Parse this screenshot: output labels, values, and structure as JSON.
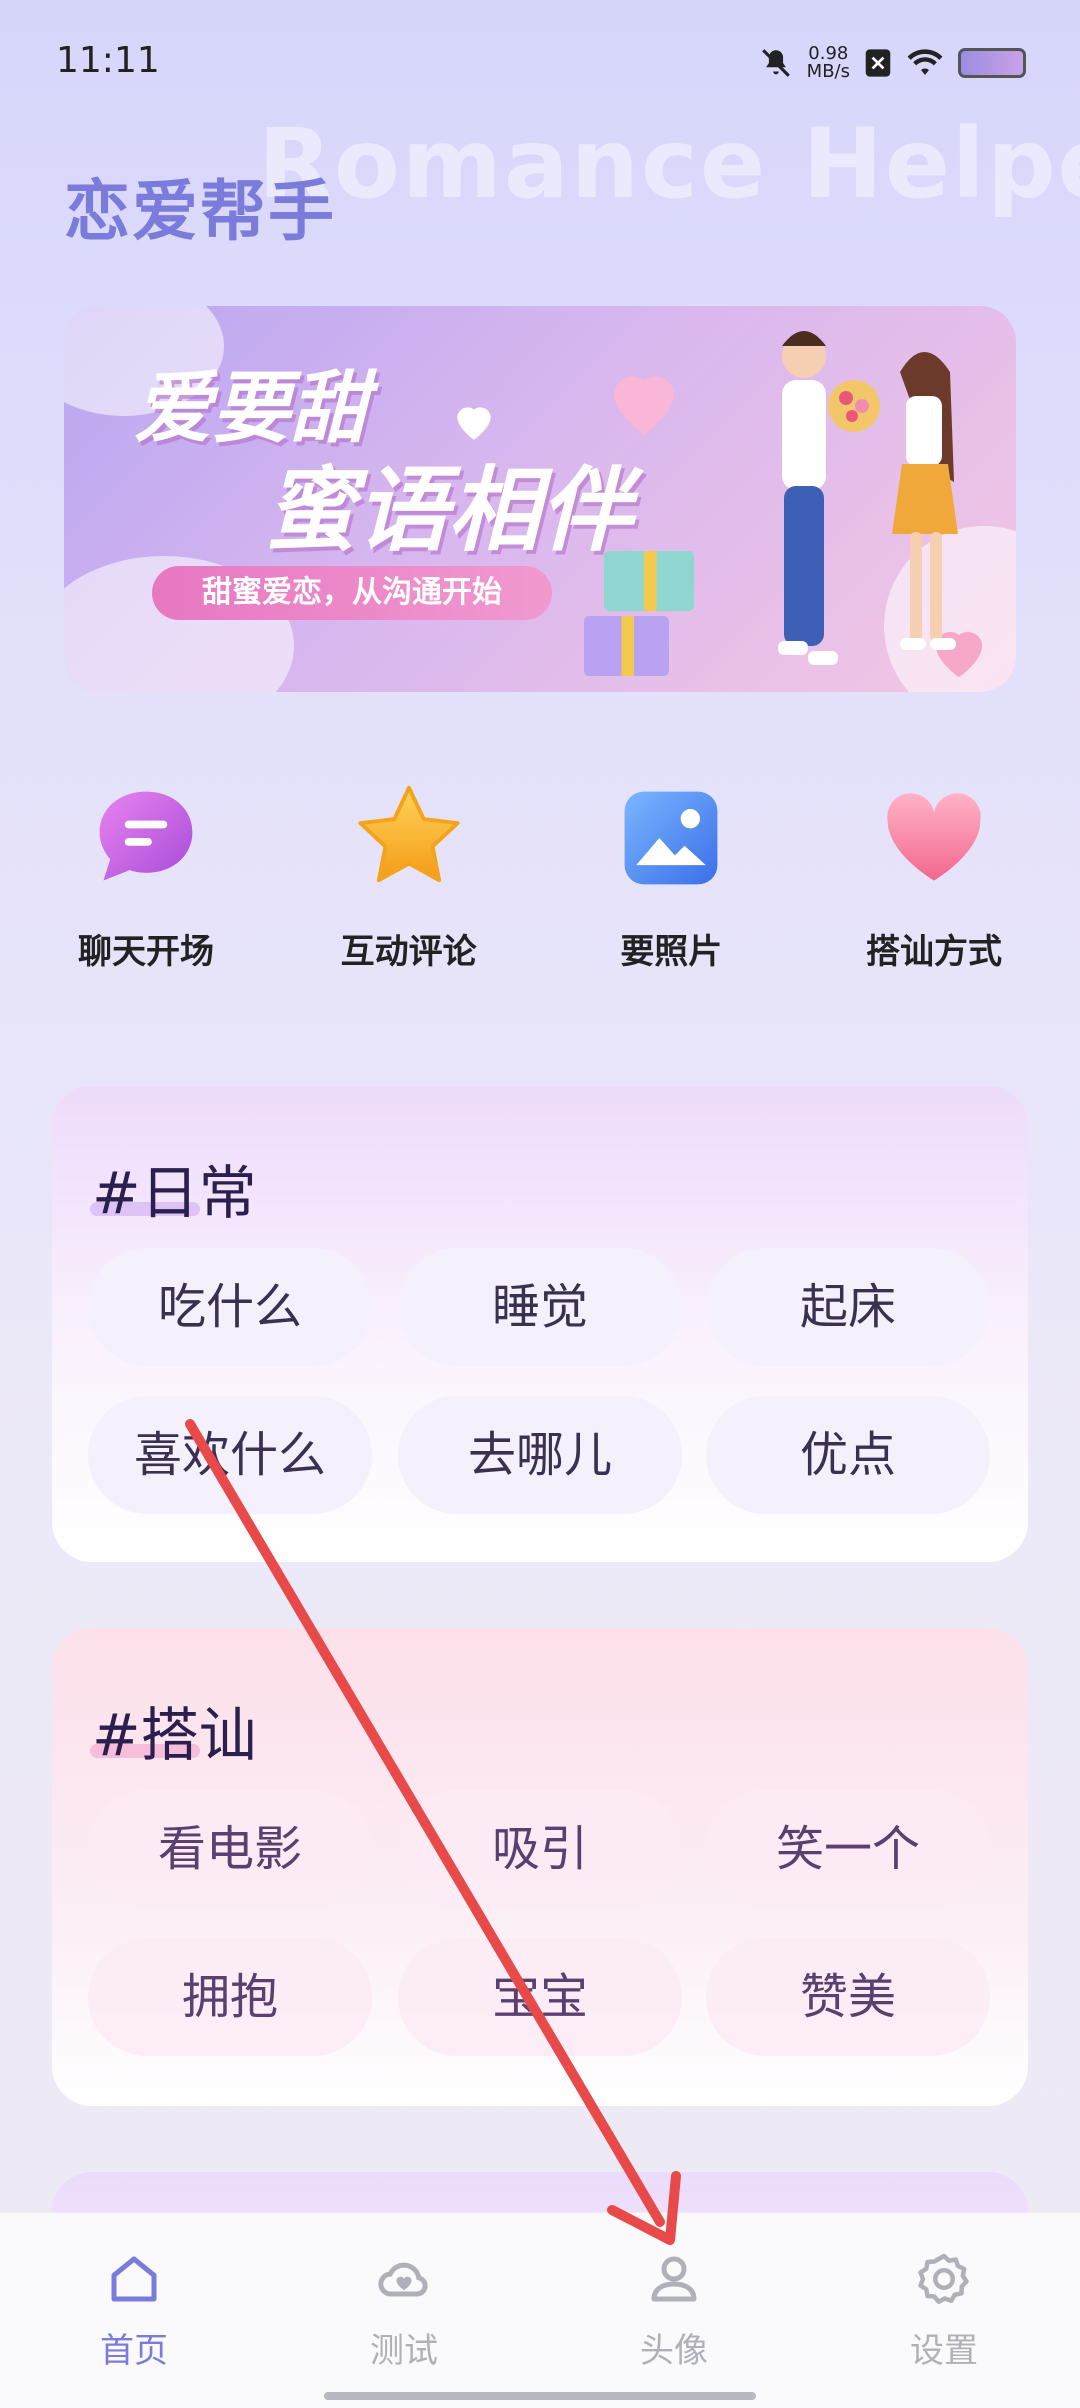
{
  "status_bar": {
    "time": "11:11",
    "net_speed_value": "0.98",
    "net_speed_unit": "MB/s",
    "icons": [
      "mute-icon",
      "net-speed-icon",
      "sim-x-icon",
      "wifi-icon",
      "battery-icon"
    ]
  },
  "header": {
    "title": "恋爱帮手",
    "watermark": "Romance Helper"
  },
  "banner": {
    "line1": "爱要甜",
    "line2": "蜜语相伴",
    "tagline": "甜蜜爱恋，从沟通开始"
  },
  "quick_actions": [
    {
      "label": "聊天开场",
      "icon": "chat-bubble-icon",
      "color": "#c86be0"
    },
    {
      "label": "互动评论",
      "icon": "star-icon",
      "color": "#f7b52a"
    },
    {
      "label": "要照片",
      "icon": "image-icon",
      "color": "#4d8df5"
    },
    {
      "label": "搭讪方式",
      "icon": "heart-icon",
      "color": "#f58aa8"
    }
  ],
  "sections": [
    {
      "title": "#日常",
      "chips": [
        "吃什么",
        "睡觉",
        "起床",
        "喜欢什么",
        "去哪儿",
        "优点"
      ]
    },
    {
      "title": "#搭讪",
      "chips": [
        "看电影",
        "吸引",
        "笑一个",
        "拥抱",
        "宝宝",
        "赞美"
      ]
    }
  ],
  "bottom_nav": {
    "items": [
      {
        "label": "首页",
        "icon": "home-icon",
        "active": true
      },
      {
        "label": "测试",
        "icon": "test-cloud-icon",
        "active": false
      },
      {
        "label": "头像",
        "icon": "user-icon",
        "active": false
      },
      {
        "label": "设置",
        "icon": "gear-icon",
        "active": false
      }
    ]
  },
  "colors": {
    "accent": "#7b7bdc",
    "annotation_arrow": "#e84a4a"
  }
}
